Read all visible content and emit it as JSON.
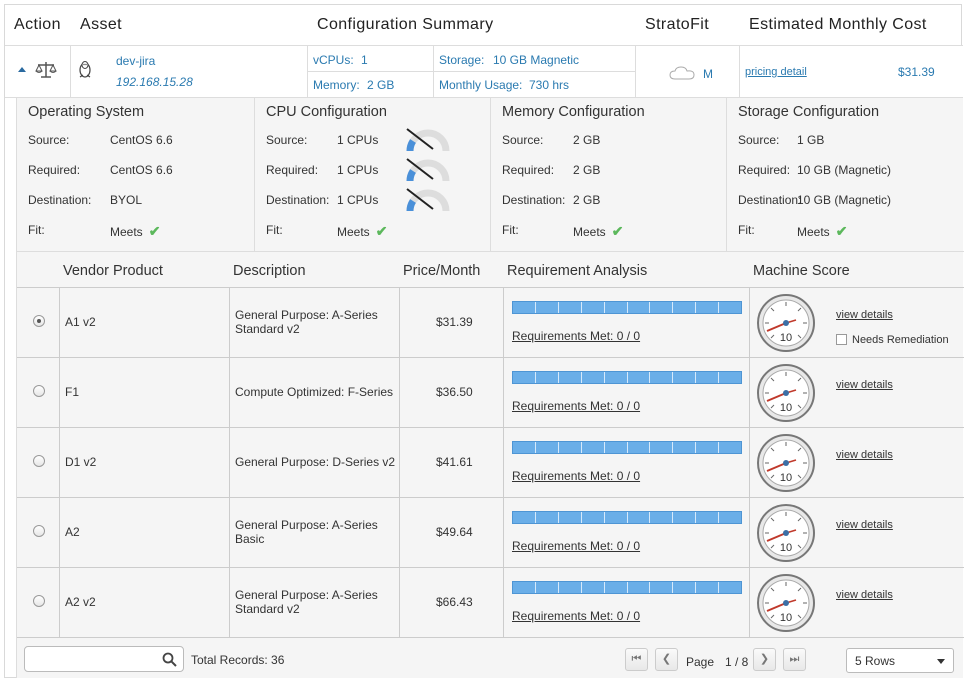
{
  "header": {
    "action": "Action",
    "asset": "Asset",
    "config_summary": "Configuration Summary",
    "stratofit": "StratoFit",
    "est_cost": "Estimated Monthly Cost"
  },
  "asset": {
    "name": "dev-jira",
    "ip": "192.168.15.28",
    "vcpus_label": "vCPUs:",
    "vcpus_value": "1",
    "memory_label": "Memory:",
    "memory_value": "2 GB",
    "storage_label": "Storage:",
    "storage_value": "10 GB Magnetic",
    "usage_label": "Monthly Usage:",
    "usage_value": "730 hrs",
    "fit_size": "M",
    "pricing_link": "pricing detail",
    "cost": "$31.39"
  },
  "configs": [
    {
      "title": "Operating System",
      "source_label": "Source:",
      "source": "CentOS 6.6",
      "required_label": "Required:",
      "required": "CentOS 6.6",
      "dest_label": "Destination:",
      "dest": "BYOL",
      "fit_label": "Fit:",
      "fit": "Meets"
    },
    {
      "title": "CPU Configuration",
      "source_label": "Source:",
      "source": "1 CPUs",
      "required_label": "Required:",
      "required": "1 CPUs",
      "dest_label": "Destination:",
      "dest": "1 CPUs",
      "fit_label": "Fit:",
      "fit": "Meets"
    },
    {
      "title": "Memory Configuration",
      "source_label": "Source:",
      "source": "2 GB",
      "required_label": "Required:",
      "required": "2 GB",
      "dest_label": "Destination:",
      "dest": "2 GB",
      "fit_label": "Fit:",
      "fit": "Meets"
    },
    {
      "title": "Storage Configuration",
      "source_label": "Source:",
      "source": "1 GB",
      "required_label": "Required:",
      "required": "10 GB (Magnetic)",
      "dest_label": "Destination:",
      "dest": "10 GB (Magnetic)",
      "fit_label": "Fit:",
      "fit": "Meets"
    }
  ],
  "table": {
    "columns": [
      "Vendor Product",
      "Description",
      "Price/Month",
      "Requirement Analysis",
      "Machine Score"
    ],
    "rows": [
      {
        "product": "A1 v2",
        "desc1": "General Purpose: A-Series",
        "desc2": "Standard v2",
        "price": "$31.39",
        "req": "Requirements Met: 0 / 0",
        "score": "10",
        "details": "view details",
        "selected": true,
        "remediation": "Needs Remediation"
      },
      {
        "product": "F1",
        "desc1": "Compute Optimized: F-Series",
        "desc2": "",
        "price": "$36.50",
        "req": "Requirements Met: 0 / 0",
        "score": "10",
        "details": "view details",
        "selected": false
      },
      {
        "product": "D1 v2",
        "desc1": "General Purpose: D-Series v2",
        "desc2": "",
        "price": "$41.61",
        "req": "Requirements Met: 0 / 0",
        "score": "10",
        "details": "view details",
        "selected": false
      },
      {
        "product": "A2",
        "desc1": "General Purpose: A-Series",
        "desc2": "Basic",
        "price": "$49.64",
        "req": "Requirements Met: 0 / 0",
        "score": "10",
        "details": "view details",
        "selected": false
      },
      {
        "product": "A2 v2",
        "desc1": "General Purpose: A-Series",
        "desc2": "Standard v2",
        "price": "$66.43",
        "req": "Requirements Met: 0 / 0",
        "score": "10",
        "details": "view details",
        "selected": false
      }
    ]
  },
  "footer": {
    "search_placeholder": "",
    "total_records": "Total Records: 36",
    "page_label": "Page",
    "page_value": "1 / 8",
    "rows_select": "5 Rows"
  },
  "colors": {
    "accent": "#2a7ab0",
    "check": "#5cb85c",
    "bar": "#6aaee8"
  },
  "icons": [
    "scale-icon",
    "linux-tux-icon",
    "cloud-icon",
    "search-icon",
    "check-icon",
    "gauge-icon"
  ]
}
